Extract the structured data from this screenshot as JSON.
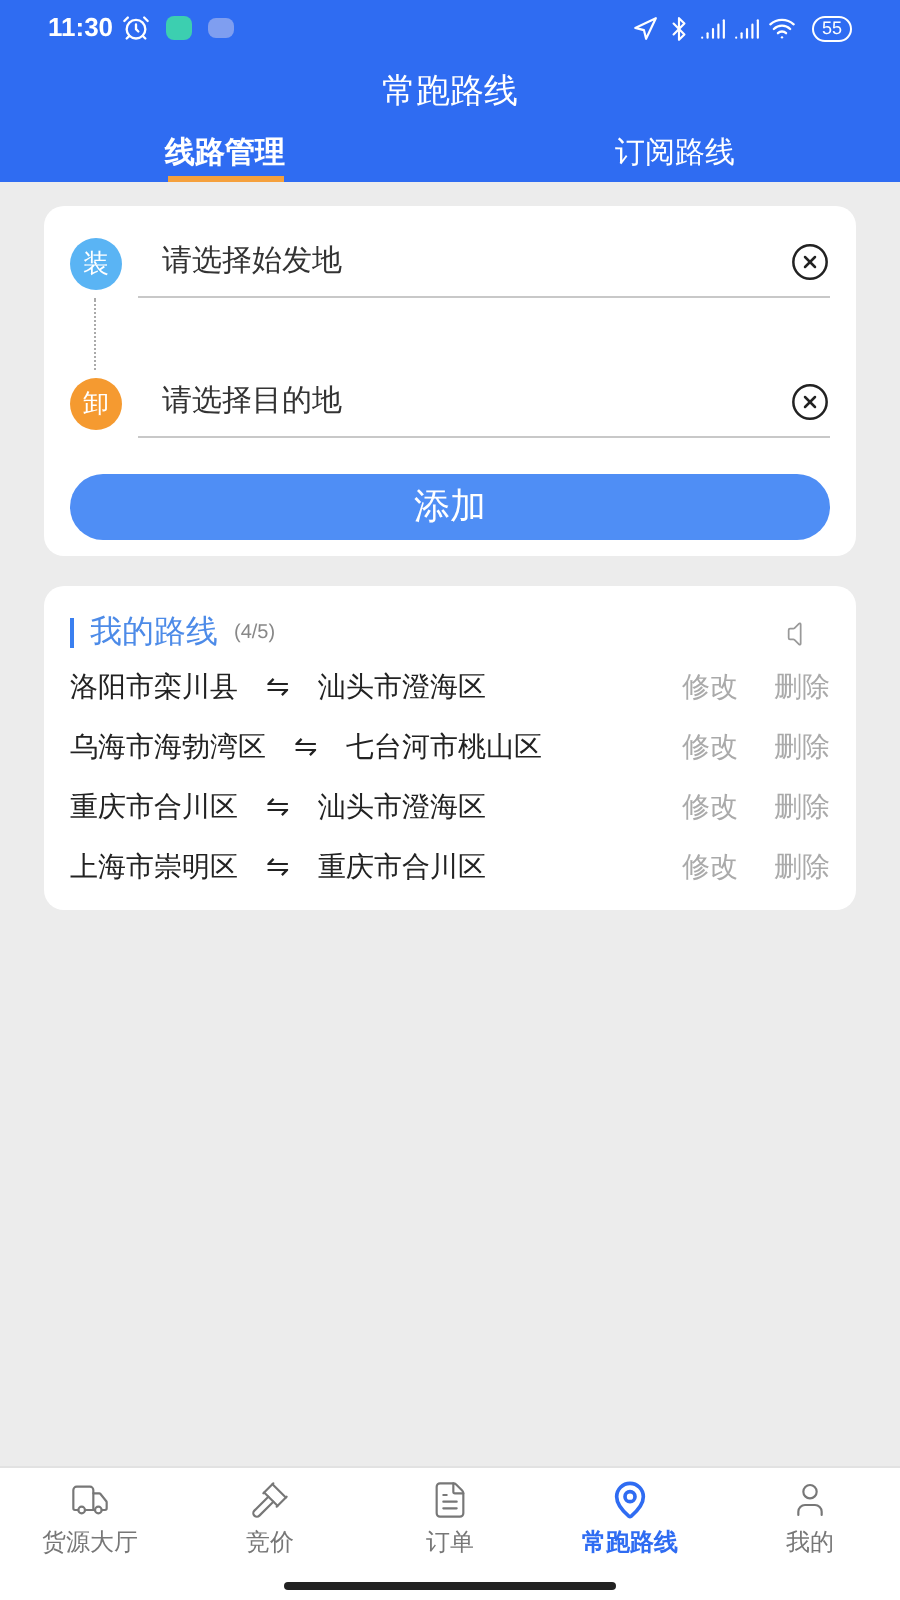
{
  "status_bar": {
    "time": "11:30",
    "battery": "55"
  },
  "header": {
    "title": "常跑路线"
  },
  "tabs": [
    {
      "label": "线路管理",
      "selected": true
    },
    {
      "label": "订阅路线",
      "selected": false
    }
  ],
  "route_form": {
    "origin": {
      "badge": "装",
      "placeholder": "请选择始发地"
    },
    "destination": {
      "badge": "卸",
      "placeholder": "请选择目的地"
    },
    "add_button": "添加"
  },
  "my_routes": {
    "title": "我的路线",
    "count": "(4/5)",
    "rows": [
      {
        "from": "洛阳市栾川县",
        "arrow": "⇋",
        "to": "汕头市澄海区",
        "edit": "修改",
        "delete": "删除"
      },
      {
        "from": "乌海市海勃湾区",
        "arrow": "⇋",
        "to": "七台河市桃山区",
        "edit": "修改",
        "delete": "删除"
      },
      {
        "from": "重庆市合川区",
        "arrow": "⇋",
        "to": "汕头市澄海区",
        "edit": "修改",
        "delete": "删除"
      },
      {
        "from": "上海市崇明区",
        "arrow": "⇋",
        "to": "重庆市合川区",
        "edit": "修改",
        "delete": "删除"
      }
    ]
  },
  "bottom_nav": [
    {
      "label": "货源大厅",
      "kind": "truck",
      "selected": false
    },
    {
      "label": "竞价",
      "kind": "gavel",
      "selected": false
    },
    {
      "label": "订单",
      "kind": "doc",
      "selected": false
    },
    {
      "label": "常跑路线",
      "kind": "pin",
      "selected": true
    },
    {
      "label": "我的",
      "kind": "user",
      "selected": false
    }
  ]
}
